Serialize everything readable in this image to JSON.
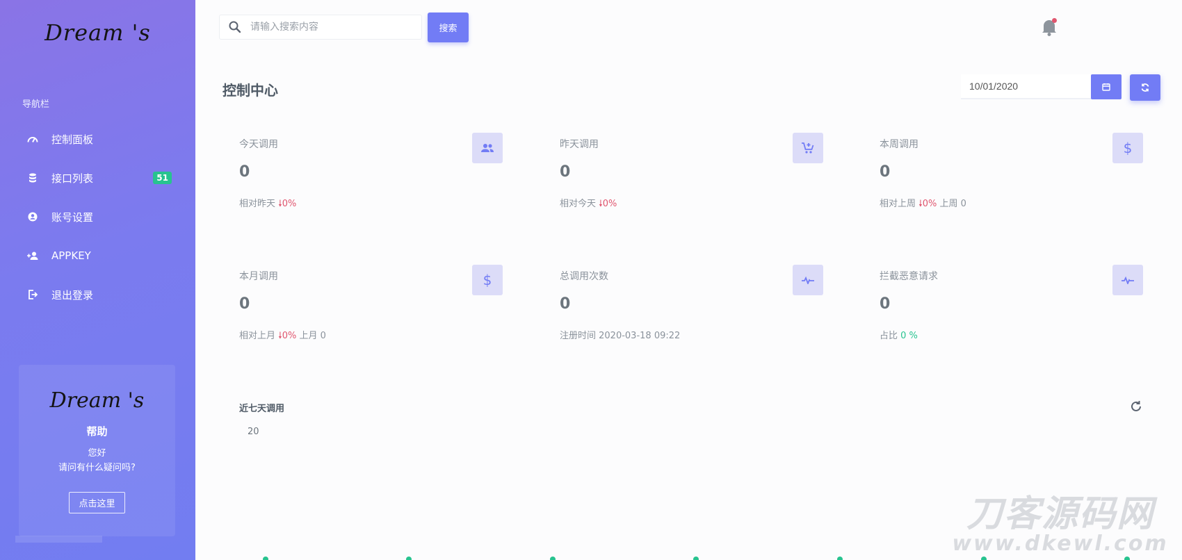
{
  "sidebar": {
    "brand": "Dream 's",
    "caption": "导航栏",
    "items": [
      {
        "label": "控制面板",
        "icon": "speedometer-icon"
      },
      {
        "label": "接口列表",
        "icon": "database-icon",
        "badge": "51"
      },
      {
        "label": "账号设置",
        "icon": "account-circle-icon"
      },
      {
        "label": "APPKEY",
        "icon": "user-plus-icon"
      },
      {
        "label": "退出登录",
        "icon": "logout-icon"
      }
    ],
    "help": {
      "logo": "Dream 's",
      "title": "帮助",
      "line1": "您好",
      "line2": "请问有什么疑问吗?",
      "button": "点击这里"
    }
  },
  "topbar": {
    "search_placeholder": "请输入搜索内容",
    "search_button": "搜索"
  },
  "header": {
    "title": "控制中心",
    "date": "10/01/2020"
  },
  "stats": [
    {
      "title": "今天调用",
      "value": "0",
      "foot_prefix": "相对昨天",
      "arrow": "🠗",
      "change": "0%",
      "foot_suffix": "",
      "icon": "users-icon"
    },
    {
      "title": "昨天调用",
      "value": "0",
      "foot_prefix": "相对今天",
      "arrow": "🠗",
      "change": "0%",
      "foot_suffix": "",
      "icon": "cart-plus-icon"
    },
    {
      "title": "本周调用",
      "value": "0",
      "foot_prefix": "相对上周",
      "arrow": "🠗",
      "change": "0%",
      "foot_suffix": "上周 0",
      "icon": "dollar-icon"
    },
    {
      "title": "本月调用",
      "value": "0",
      "foot_prefix": "相对上月",
      "arrow": "🠗",
      "change": "0%",
      "foot_suffix": "上月 0",
      "icon": "dollar-icon"
    },
    {
      "title": "总调用次数",
      "value": "0",
      "foot_prefix": "注册时间 2020-03-18 09:22",
      "arrow": "",
      "change": "",
      "foot_suffix": "",
      "icon": "pulse-icon"
    },
    {
      "title": "拦截恶意请求",
      "value": "0",
      "foot_prefix": "占比",
      "arrow": "",
      "change": "0 %",
      "foot_suffix": "",
      "icon": "pulse-icon"
    }
  ],
  "chart": {
    "title": "近七天调用",
    "ytick": "20"
  },
  "watermark": {
    "line1": "刀客源码网",
    "line2": "www.dkewl.com"
  },
  "colors": {
    "accent": "#727cf5",
    "success": "#27c38f",
    "danger": "#e0566f"
  }
}
